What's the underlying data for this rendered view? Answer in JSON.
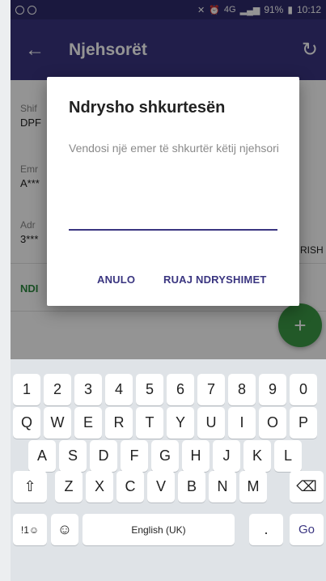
{
  "status_bar": {
    "network": "4G",
    "battery": "91%",
    "time": "10:12"
  },
  "app_bar": {
    "title": "Njehsorët"
  },
  "background": {
    "field1_label": "Shif",
    "field1_value": "DPF",
    "field2_label": "Emr",
    "field2_value": "A***",
    "field3_label": "Adr",
    "field3_value": "3***",
    "field3_suffix": "RISH",
    "action_label": "NDI"
  },
  "fab": {
    "label": "+"
  },
  "dialog": {
    "title": "Ndrysho shkurtesën",
    "message": "Vendosi një emer të shkurtër këtij njehsori",
    "input_value": "",
    "cancel_label": "ANULO",
    "save_label": "RUAJ NDRYSHIMET"
  },
  "keyboard": {
    "row_numbers": [
      "1",
      "2",
      "3",
      "4",
      "5",
      "6",
      "7",
      "8",
      "9",
      "0"
    ],
    "row1": [
      "Q",
      "W",
      "E",
      "R",
      "T",
      "Y",
      "U",
      "I",
      "O",
      "P"
    ],
    "row2": [
      "A",
      "S",
      "D",
      "F",
      "G",
      "H",
      "J",
      "K",
      "L"
    ],
    "row3": [
      "Z",
      "X",
      "C",
      "V",
      "B",
      "N",
      "M"
    ],
    "symbols_label": "!1☺",
    "space_label": "English (UK)",
    "period_label": ".",
    "go_label": "Go"
  },
  "colors": {
    "primary": "#3a3580",
    "status_bar": "#2e2a6b",
    "fab": "#3b9a46"
  }
}
